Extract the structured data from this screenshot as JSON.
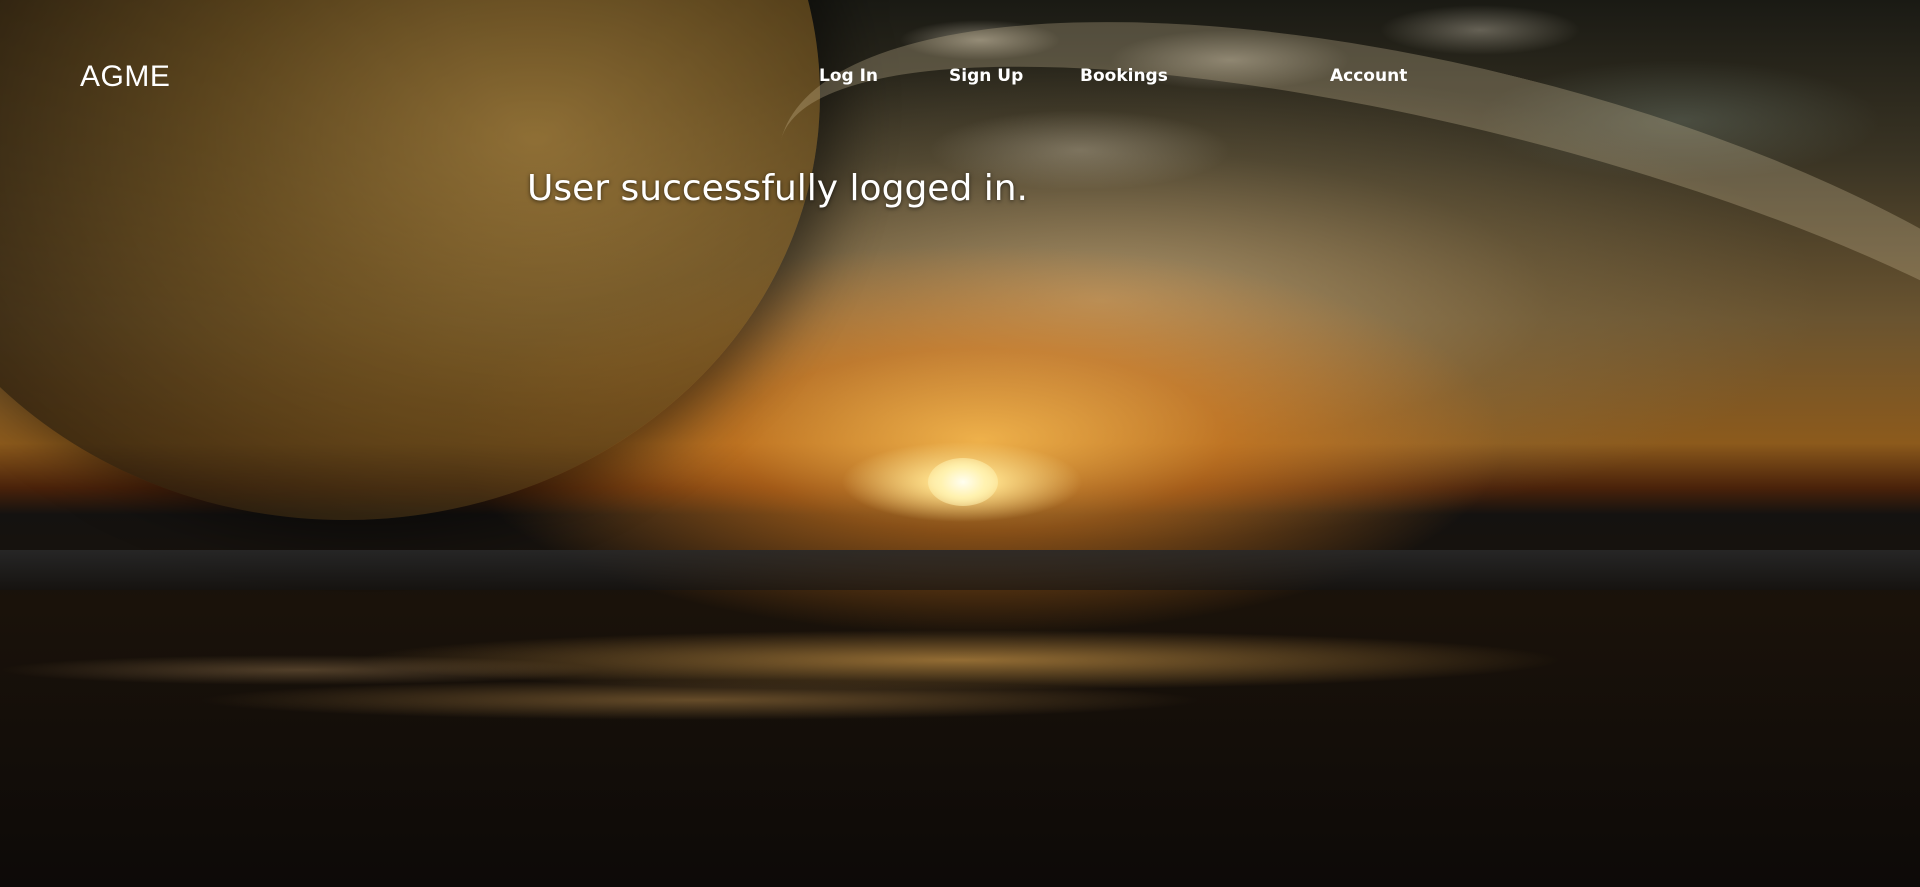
{
  "brand": {
    "logo_text": "AGME"
  },
  "nav": {
    "items": [
      {
        "label": "Log In"
      },
      {
        "label": "Sign Up"
      },
      {
        "label": "Bookings"
      },
      {
        "label": "Account"
      }
    ]
  },
  "main": {
    "message": "User successfully logged in."
  },
  "colors": {
    "text": "#ffffff"
  }
}
